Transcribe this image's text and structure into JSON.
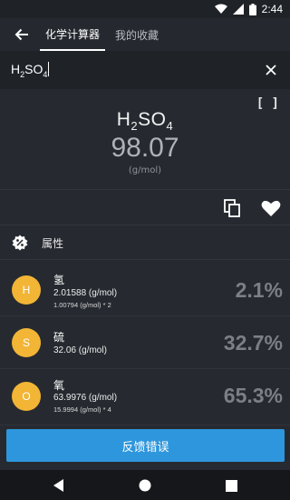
{
  "status_bar": {
    "time": "2:44"
  },
  "app_bar": {
    "tabs": [
      {
        "label": "化学计算器",
        "active": true
      },
      {
        "label": "我的收藏",
        "active": false
      }
    ]
  },
  "search": {
    "query_parts": {
      "h": "H",
      "h_sub": "2",
      "so": "SO",
      "o_sub": "4"
    }
  },
  "result": {
    "formula": {
      "h": "H",
      "h_sub": "2",
      "so": "SO",
      "o_sub": "4"
    },
    "molar_mass": "98.07",
    "unit": "(g/mol)",
    "bracket_toggle": "[ ]"
  },
  "properties": {
    "title": "属性",
    "elements": [
      {
        "symbol": "H",
        "name": "氢",
        "mass": "2.01588 (g/mol)",
        "detail": "1.00794 (g/mol) * 2",
        "percent": "2.1%"
      },
      {
        "symbol": "S",
        "name": "硫",
        "mass": "32.06 (g/mol)",
        "detail": "",
        "percent": "32.7%"
      },
      {
        "symbol": "O",
        "name": "氧",
        "mass": "63.9976 (g/mol)",
        "detail": "15.9994 (g/mol) * 4",
        "percent": "65.3%"
      }
    ]
  },
  "report_button": {
    "label": "反馈错误"
  },
  "colors": {
    "accent": "#2e96dc",
    "badge": "#f2b535",
    "background": "#262a30"
  }
}
